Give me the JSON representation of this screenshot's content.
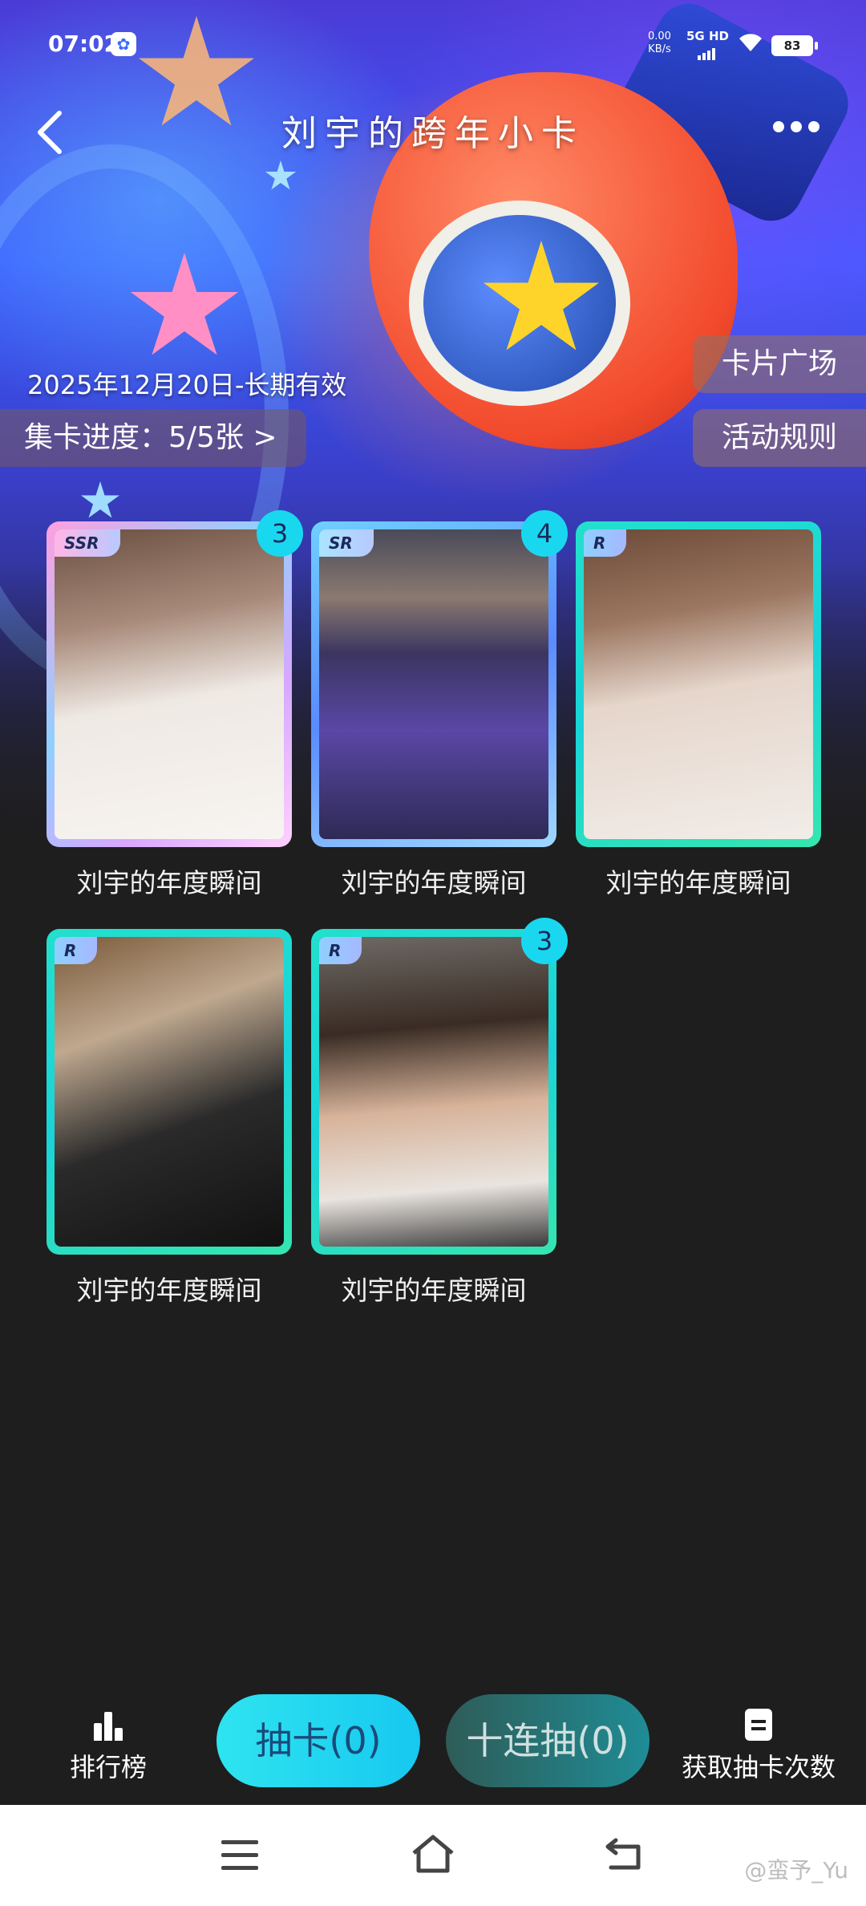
{
  "status_bar": {
    "time": "07:02",
    "net_speed_value": "0.00",
    "net_speed_unit": "KB/s",
    "network": "5G HD",
    "battery": "83"
  },
  "header": {
    "title": "刘宇的跨年小卡"
  },
  "banner": {
    "validity": "2025年12月20日-长期有效",
    "progress": "集卡进度：5/5张 >",
    "card_plaza": "卡片广场",
    "rules": "活动规则"
  },
  "cards": [
    {
      "rarity": "SSR",
      "count": "3",
      "label": "刘宇的年度瞬间"
    },
    {
      "rarity": "SR",
      "count": "4",
      "label": "刘宇的年度瞬间"
    },
    {
      "rarity": "R",
      "count": "",
      "label": "刘宇的年度瞬间"
    },
    {
      "rarity": "R",
      "count": "",
      "label": "刘宇的年度瞬间"
    },
    {
      "rarity": "R",
      "count": "3",
      "label": "刘宇的年度瞬间"
    }
  ],
  "actions": {
    "ranking": "排行榜",
    "draw": "抽卡(0)",
    "draw_ten": "十连抽(0)",
    "get_draws": "获取抽卡次数"
  },
  "watermark": "@蛮予_Yu",
  "colors": {
    "accent_cyan": "#1ad7f0",
    "background": "#1e1e1e"
  }
}
